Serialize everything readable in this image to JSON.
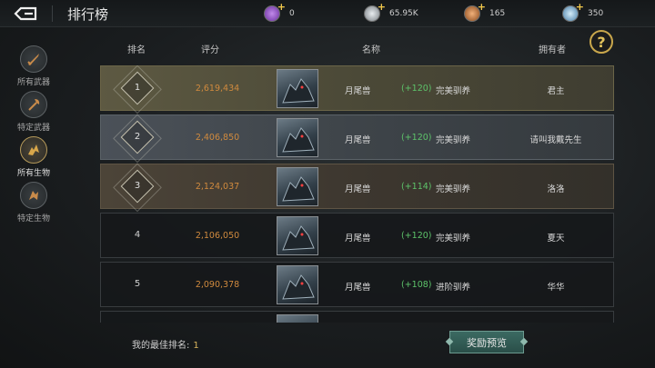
{
  "header": {
    "title": "排行榜",
    "currencies": [
      {
        "name": "purple-gem-icon",
        "value": "0",
        "color": "#9b59d0"
      },
      {
        "name": "silver-coin-icon",
        "value": "65.95K",
        "color": "#b8bcc0"
      },
      {
        "name": "copper-coin-icon",
        "value": "165",
        "color": "#c87a3a"
      },
      {
        "name": "blue-orb-icon",
        "value": "350",
        "color": "#6fa3c8"
      }
    ]
  },
  "sidebar": {
    "items": [
      {
        "label": "所有武器",
        "icon": "sword-icon",
        "active": false
      },
      {
        "label": "特定武器",
        "icon": "axe-icon",
        "active": false
      },
      {
        "label": "所有生物",
        "icon": "beast-icon",
        "active": true
      },
      {
        "label": "特定生物",
        "icon": "dragon-icon",
        "active": false
      }
    ]
  },
  "table": {
    "headers": {
      "rank": "排名",
      "score": "评分",
      "name": "名称",
      "owner": "拥有者"
    },
    "rows": [
      {
        "rank": "1",
        "score": "2,619,434",
        "name": "月尾兽",
        "bonus": "(+120)",
        "tame": "完美驯养",
        "owner": "君主"
      },
      {
        "rank": "2",
        "score": "2,406,850",
        "name": "月尾兽",
        "bonus": "(+120)",
        "tame": "完美驯养",
        "owner": "请叫我戴先生"
      },
      {
        "rank": "3",
        "score": "2,124,037",
        "name": "月尾兽",
        "bonus": "(+114)",
        "tame": "完美驯养",
        "owner": "洛洛"
      },
      {
        "rank": "4",
        "score": "2,106,050",
        "name": "月尾兽",
        "bonus": "(+120)",
        "tame": "完美驯养",
        "owner": "夏天"
      },
      {
        "rank": "5",
        "score": "2,090,378",
        "name": "月尾兽",
        "bonus": "(+108)",
        "tame": "进阶驯养",
        "owner": "华华"
      }
    ]
  },
  "footer": {
    "best_rank_label": "我的最佳排名:",
    "best_rank_value": "1",
    "reward_button": "奖励预览"
  },
  "help": {
    "label": "?"
  },
  "colors": {
    "score": "#d08a3e",
    "bonus": "#5dc36a",
    "accent": "#c9a74c"
  }
}
